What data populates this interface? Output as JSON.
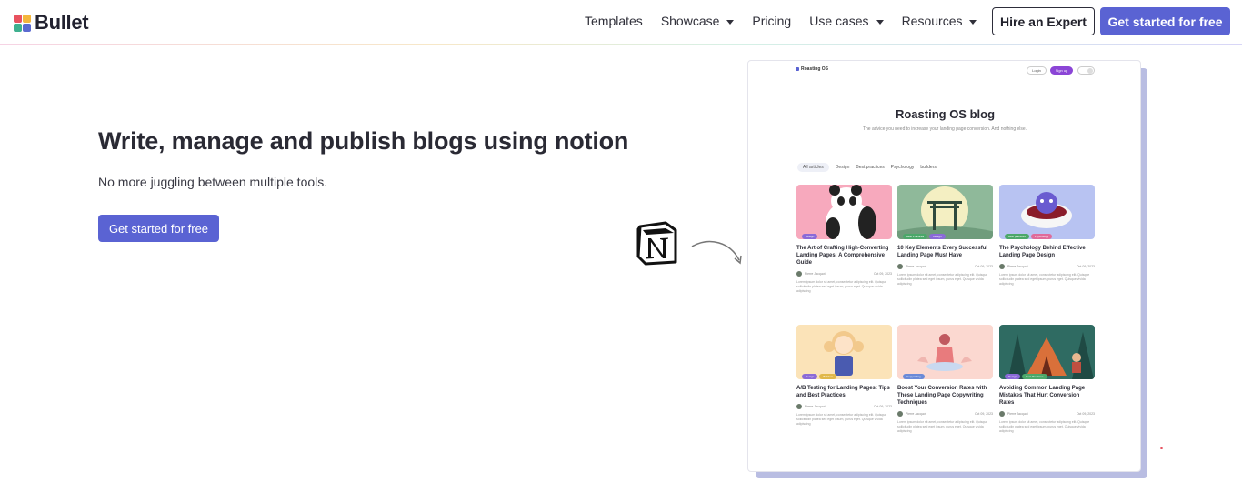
{
  "brand": {
    "name": "Bullet"
  },
  "nav": {
    "items": [
      {
        "label": "Templates",
        "has_dropdown": false
      },
      {
        "label": "Showcase",
        "has_dropdown": true
      },
      {
        "label": "Pricing",
        "has_dropdown": false
      },
      {
        "label": "Use cases",
        "has_dropdown": true
      },
      {
        "label": "Resources",
        "has_dropdown": true
      }
    ],
    "hire_label": "Hire an Expert",
    "cta_label": "Get started for free"
  },
  "hero": {
    "title": "Write, manage and publish blogs using notion",
    "subtitle": "No more juggling between multiple tools.",
    "cta_label": "Get started for free"
  },
  "preview": {
    "site_name": "Roasting OS",
    "login_label": "Login",
    "signup_label": "Sign up",
    "blog_title": "Roasting OS blog",
    "blog_desc": "The advice you need to increase your landing page conversion. And nothing else.",
    "filters": [
      "All articles",
      "Design",
      "Best practices",
      "Psychology",
      "builders"
    ],
    "cards": [
      {
        "title": "The Art of Crafting High-Converting Landing Pages: A Comprehensive Guide",
        "author": "Pierre Jacquot",
        "date": "Oct 09, 2023",
        "tags": [
          "Design"
        ],
        "text": "Lorem ipsum dolor sit amet, consectetur adipiscing elit. Quisque sollicitudin platea sed eget ipsum, purus eget. Quisque vivida adipiscing"
      },
      {
        "title": "10 Key Elements Every Successful Landing Page Must Have",
        "author": "Pierre Jacquot",
        "date": "Oct 09, 2023",
        "tags": [
          "Best Practices",
          "Design"
        ],
        "text": "Lorem ipsum dolor sit amet, consectetur adipiscing elit. Quisque sollicitudin platea sed eget ipsum, purus eget. Quisque vivida adipiscing"
      },
      {
        "title": "The Psychology Behind Effective Landing Page Design",
        "author": "Pierre Jacquot",
        "date": "Oct 09, 2023",
        "tags": [
          "Best practices",
          "Psychology"
        ],
        "text": "Lorem ipsum dolor sit amet, consectetur adipiscing elit. Quisque sollicitudin platea sed eget ipsum, purus eget. Quisque vivida adipiscing"
      },
      {
        "title": "A/B Testing for Landing Pages: Tips and Best Practices",
        "author": "Pierre Jacquot",
        "date": "Oct 09, 2023",
        "tags": [
          "Design",
          "Builders"
        ],
        "text": "Lorem ipsum dolor sit amet, consectetur adipiscing elit. Quisque sollicitudin platea sed eget ipsum, purus eget. Quisque vivida adipiscing"
      },
      {
        "title": "Boost Your Conversion Rates with These Landing Page Copywriting Techniques",
        "author": "Pierre Jacquot",
        "date": "Oct 09, 2023",
        "tags": [
          "Copywriting"
        ],
        "text": "Lorem ipsum dolor sit amet, consectetur adipiscing elit. Quisque sollicitudin platea sed eget ipsum, purus eget. Quisque vivida adipiscing"
      },
      {
        "title": "Avoiding Common Landing Page Mistakes That Hurt Conversion Rates",
        "author": "Pierre Jacquot",
        "date": "Oct 09, 2023",
        "tags": [
          "Design",
          "Best Practices"
        ],
        "text": "Lorem ipsum dolor sit amet, consectetur adipiscing elit. Quisque sollicitudin platea sed eget ipsum, purus eget. Quisque vivida adipiscing"
      }
    ]
  },
  "colors": {
    "primary": "#5a63d3",
    "text_dark": "#2a2a34",
    "preview_shadow": "#b9bde2",
    "signup": "#8b45d6"
  }
}
